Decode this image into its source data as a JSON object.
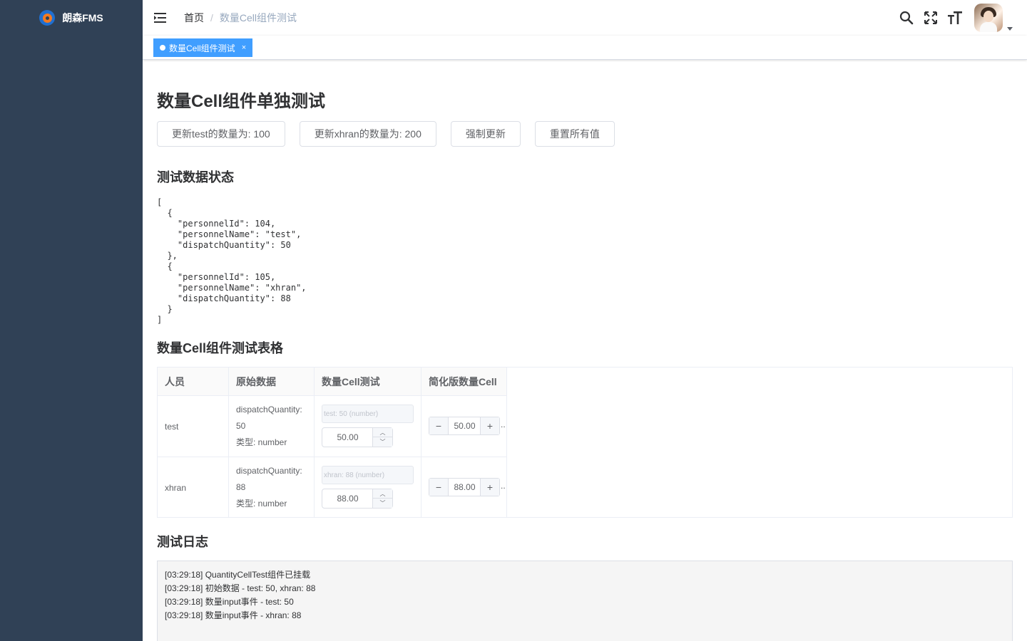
{
  "app": {
    "title": "朗森FMS"
  },
  "breadcrumb": {
    "home": "首页",
    "separator": "/",
    "current": "数量Cell组件测试"
  },
  "tags": [
    {
      "label": "数量Cell组件测试",
      "close": "×"
    }
  ],
  "icons": {
    "hamburger": "menu-fold-icon",
    "search": "search-icon",
    "fullscreen": "fullscreen-icon",
    "size": "font-size-icon",
    "caret": "caret-down-icon"
  },
  "colors": {
    "sidebar": "#304156",
    "accent": "#409eff"
  },
  "page": {
    "title": "数量Cell组件单独测试",
    "buttons": [
      {
        "label": "更新test的数量为: 100"
      },
      {
        "label": "更新xhran的数量为: 200"
      },
      {
        "label": "强制更新"
      },
      {
        "label": "重置所有值"
      }
    ],
    "state_section": {
      "title": "测试数据状态"
    },
    "json_text": "[\n  {\n    \"personnelId\": 104,\n    \"personnelName\": \"test\",\n    \"dispatchQuantity\": 50\n  },\n  {\n    \"personnelId\": 105,\n    \"personnelName\": \"xhran\",\n    \"dispatchQuantity\": 88\n  }\n]",
    "table_section": {
      "title": "数量Cell组件测试表格"
    },
    "table": {
      "headers": [
        "人员",
        "原始数据",
        "数量Cell测试",
        "简化版数量Cell"
      ],
      "rows": [
        {
          "person": "test",
          "raw_line1": "dispatchQuantity:",
          "raw_line2": "50",
          "raw_type": "类型: number",
          "info": "test: 50 (number)",
          "input_value": "50.00",
          "stepper_value": "50.00",
          "ellipsis": ".."
        },
        {
          "person": "xhran",
          "raw_line1": "dispatchQuantity:",
          "raw_line2": "88",
          "raw_type": "类型: number",
          "info": "xhran: 88 (number)",
          "input_value": "88.00",
          "stepper_value": "88.00",
          "ellipsis": ".."
        }
      ],
      "stepper_minus": "−",
      "stepper_plus": "+",
      "arrow_up": "︿",
      "arrow_down": "﹀"
    },
    "log_section": {
      "title": "测试日志"
    },
    "log": [
      "[03:29:18] QuantityCellTest组件已挂载",
      "[03:29:18] 初始数据 - test: 50, xhran: 88",
      "[03:29:18] 数量input事件 - test: 50",
      "[03:29:18] 数量input事件 - xhran: 88"
    ]
  }
}
